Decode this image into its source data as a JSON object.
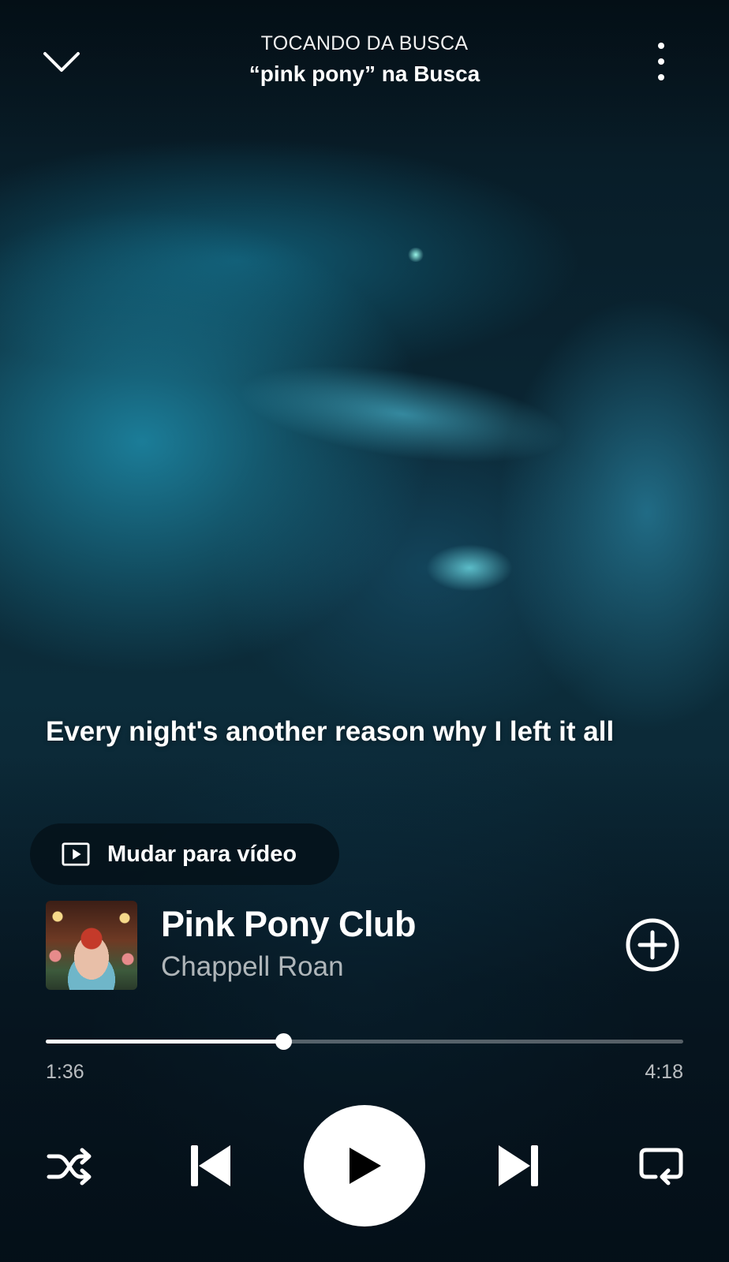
{
  "header": {
    "context_label": "TOCANDO DA BUSCA",
    "context_title": "“pink pony” na Busca",
    "collapse_icon": "chevron-down-icon",
    "more_icon": "more-vertical-icon"
  },
  "lyrics": {
    "current_line": "Every night's another reason why I left it all"
  },
  "video_switch": {
    "label": "Mudar para vídeo",
    "icon": "video-play-icon"
  },
  "track": {
    "title": "Pink Pony Club",
    "artist": "Chappell Roan",
    "add_icon": "add-circle-icon"
  },
  "playback": {
    "elapsed": "1:36",
    "total": "4:18",
    "progress_fraction": 0.372,
    "state": "paused"
  },
  "controls": {
    "shuffle_icon": "shuffle-icon",
    "previous_icon": "skip-previous-icon",
    "play_icon": "play-icon",
    "next_icon": "skip-next-icon",
    "repeat_icon": "repeat-icon"
  },
  "colors": {
    "accent": "#ffffff",
    "play_button_bg": "#ffffff",
    "play_icon": "#000000",
    "background_tint": "#0c2c3a"
  }
}
